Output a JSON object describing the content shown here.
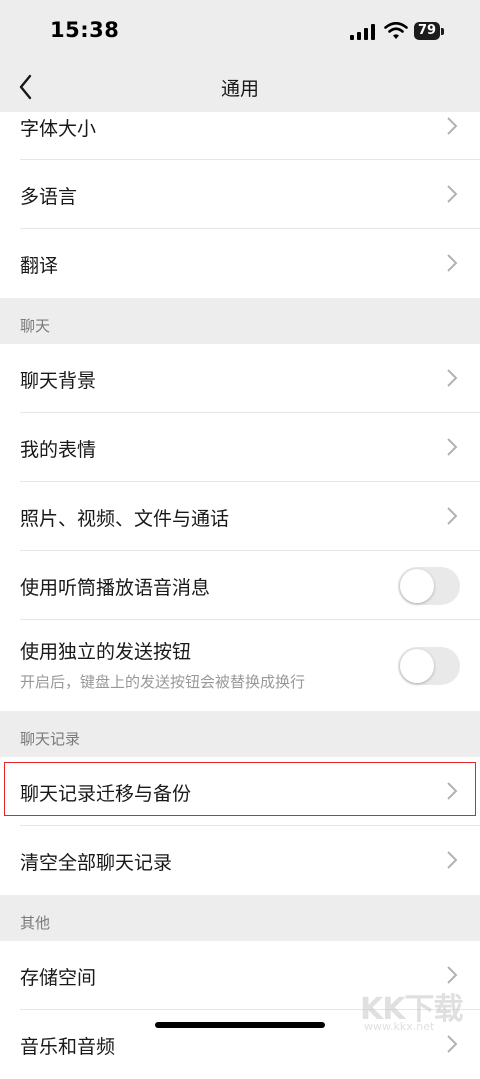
{
  "status": {
    "time": "15:38",
    "battery": "79"
  },
  "nav": {
    "title": "通用"
  },
  "rows_top": [
    {
      "label": "字体大小"
    },
    {
      "label": "多语言"
    },
    {
      "label": "翻译"
    }
  ],
  "sections": {
    "chat": "聊天",
    "history": "聊天记录",
    "other": "其他"
  },
  "chat_rows": [
    {
      "label": "聊天背景"
    },
    {
      "label": "我的表情"
    },
    {
      "label": "照片、视频、文件与通话"
    },
    {
      "label": "使用听筒播放语音消息",
      "toggle": false
    },
    {
      "label": "使用独立的发送按钮",
      "sub": "开启后，键盘上的发送按钮会被替换成换行",
      "toggle": false
    }
  ],
  "history_rows": [
    {
      "label": "聊天记录迁移与备份"
    },
    {
      "label": "清空全部聊天记录"
    }
  ],
  "other_rows": [
    {
      "label": "存储空间"
    },
    {
      "label": "音乐和音频"
    }
  ],
  "watermark": {
    "text": "KK下载",
    "url": "www.kkx.net"
  }
}
